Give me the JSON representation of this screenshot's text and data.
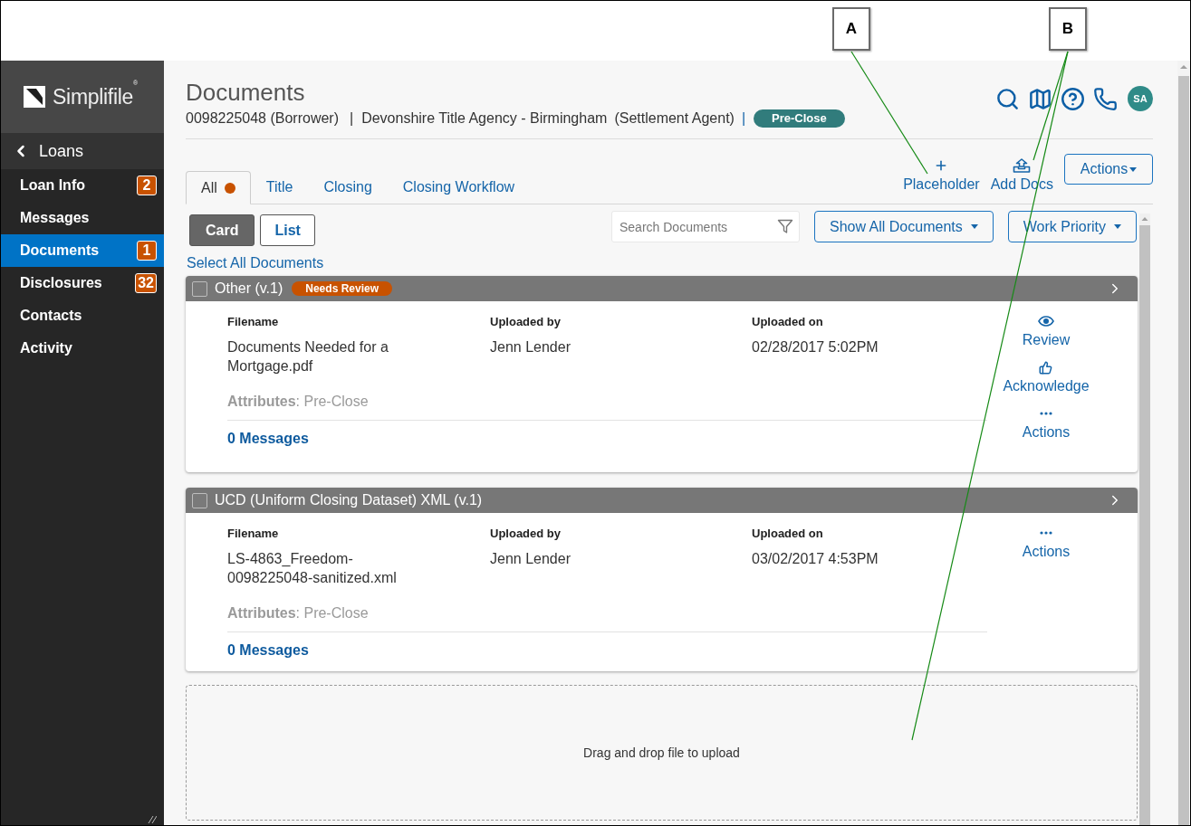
{
  "callouts": [
    {
      "label": "A"
    },
    {
      "label": "B"
    }
  ],
  "sidebar": {
    "brand": "Simplifile$^{®}$",
    "back_link": "Loans",
    "items": [
      {
        "label": "Loan Info",
        "badge": "2",
        "selected": false
      },
      {
        "label": "Messages",
        "selected": false
      },
      {
        "label": "Documents",
        "badge": "1",
        "selected": true
      },
      {
        "label": "Disclosures",
        "badge": "32",
        "selected": false
      },
      {
        "label": "Contacts",
        "selected": false
      },
      {
        "label": "Activity",
        "selected": false
      }
    ]
  },
  "header": {
    "title": "Documents",
    "borrower": "0098225048 (Borrower)",
    "separator_1": "|",
    "agency": "Devonshire Title Agency - Birmingham",
    "agency_role": "(Settlement Agent)",
    "separator_2": "|",
    "status": "Pre-Close",
    "avatar_initials": "SA"
  },
  "tabs": [
    {
      "label": "All",
      "selected": true,
      "alert_dot": true
    },
    {
      "label": "Title",
      "selected": false,
      "alert_dot": false
    },
    {
      "label": "Closing",
      "selected": false,
      "alert_dot": false
    },
    {
      "label": "Closing Workflow",
      "selected": false,
      "alert_dot": false
    }
  ],
  "tab_actions": [
    {
      "kind": "placeholder",
      "label": "Placeholder"
    },
    {
      "kind": "add_docs",
      "label": "Add Docs"
    }
  ],
  "actions_menu": {
    "label": "Actions"
  },
  "view_modes": [
    {
      "label": "Card",
      "selected": true
    },
    {
      "label": "List",
      "selected": false
    }
  ],
  "search": {
    "placeholder": "Search Documents"
  },
  "dropdowns": [
    {
      "label": "Show All Documents"
    },
    {
      "label": "Work Priority"
    }
  ],
  "select_all": "Select All Documents",
  "documents": [
    {
      "title": "Other (v.1)",
      "checked": false,
      "badge": "Needs Review",
      "columns": [
        {
          "label": "Filename",
          "value": "Documents Needed for a Mortgage.pdf"
        },
        {
          "label": "Uploaded by",
          "value": "Jenn Lender"
        },
        {
          "label": "Uploaded on",
          "value": "02/28/2017 5:02PM"
        }
      ],
      "attributes": "**Attributes**: Pre-Close",
      "messages": "0 Messages",
      "actions": [
        {
          "kind": "review",
          "label": "Review"
        },
        {
          "kind": "acknowledge",
          "label": "Acknowledge"
        },
        {
          "kind": "more",
          "label": "Actions"
        }
      ]
    },
    {
      "title": "UCD (Uniform Closing Dataset) XML (v.1)",
      "checked": false,
      "columns": [
        {
          "label": "Filename",
          "value": "LS-4863_Freedom-0098225048-sanitized.xml"
        },
        {
          "label": "Uploaded by",
          "value": "Jenn Lender"
        },
        {
          "label": "Uploaded on",
          "value": "03/02/2017 4:53PM"
        }
      ],
      "attributes": "**Attributes**: Pre-Close",
      "messages": "0 Messages",
      "actions": [
        {
          "kind": "more",
          "label": "Actions"
        }
      ]
    }
  ],
  "drop_zone": "Drag and drop file to upload"
}
